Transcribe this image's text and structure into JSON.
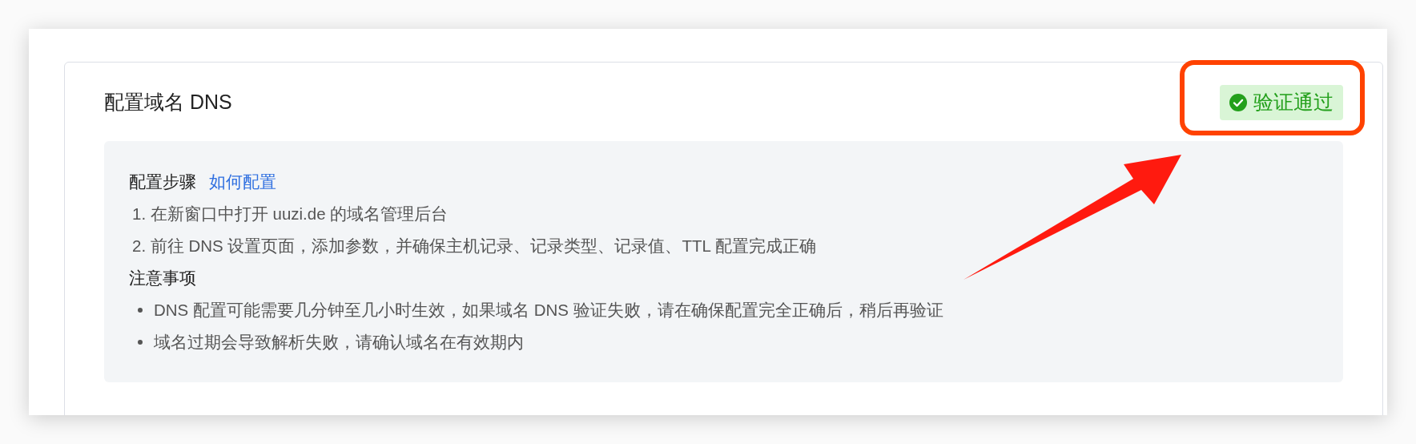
{
  "card": {
    "title": "配置域名 DNS",
    "badge": {
      "label": "验证通过",
      "verified": true
    }
  },
  "guide": {
    "steps_heading": "配置步骤",
    "help_link": "如何配置",
    "steps": [
      "1. 在新窗口中打开 uuzi.de 的域名管理后台",
      "2. 前往 DNS 设置页面，添加参数，并确保主机记录、记录类型、记录值、TTL 配置完成正确"
    ],
    "notes_heading": "注意事项",
    "notes": [
      "DNS 配置可能需要几分钟至几小时生效，如果域名 DNS 验证失败，请在确保配置完全正确后，稍后再验证",
      "域名过期会导致解析失败，请确认域名在有效期内"
    ]
  }
}
